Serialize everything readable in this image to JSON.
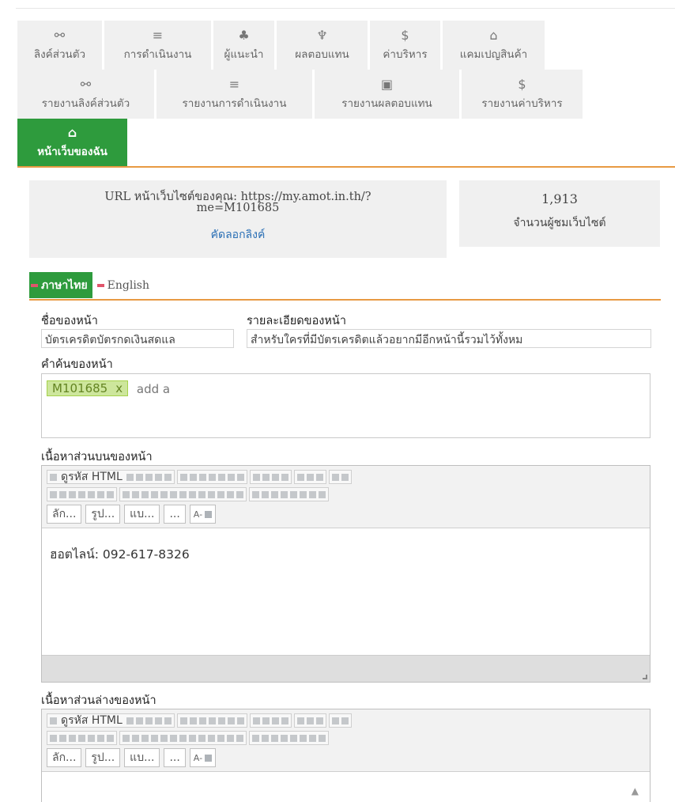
{
  "nav_row1": [
    {
      "icon": "link-icon",
      "glyph": "⚯",
      "label": "ลิงค์ส่วนตัว"
    },
    {
      "icon": "list-icon",
      "glyph": "≡",
      "label": "การดำเนินงาน"
    },
    {
      "icon": "org-chart-icon",
      "glyph": "♣",
      "label": "ผู้แนะนำ"
    },
    {
      "icon": "trophy-icon",
      "glyph": "♆",
      "label": "ผลตอบแทน"
    },
    {
      "icon": "dollar-icon",
      "glyph": "$",
      "label": "ค่าบริหาร"
    },
    {
      "icon": "gift-icon",
      "glyph": "⌂",
      "label": "แคมเปญสินค้า"
    }
  ],
  "nav_row2": [
    {
      "icon": "link-icon",
      "glyph": "⚯",
      "label": "รายงานลิงค์ส่วนตัว"
    },
    {
      "icon": "list-icon",
      "glyph": "≡",
      "label": "รายงานการดำเนินงาน"
    },
    {
      "icon": "money-icon",
      "glyph": "▣",
      "label": "รายงานผลตอบแทน"
    },
    {
      "icon": "dollar-icon",
      "glyph": "$",
      "label": "รายงานค่าบริหาร"
    }
  ],
  "nav_active": {
    "icon": "home-icon",
    "glyph": "⌂",
    "label": "หน้าเว็บของฉัน"
  },
  "url_info": {
    "line1": "URL หน้าเว็บไซต์ของคุณ: https://my.amot.in.th/?",
    "line2": "me=M101685",
    "copy_link": "คัดลอกลิงค์"
  },
  "visitors": {
    "count": "1,913",
    "label": "จำนวนผู้ชมเว็บไซต์"
  },
  "languages": {
    "active": "ภาษาไทย",
    "inactive": "English"
  },
  "form": {
    "page_name_label": "ชื่อของหน้า",
    "page_name_value": "บัตรเครดิตบัตรกดเงินสดแล",
    "page_desc_label": "รายละเอียดของหน้า",
    "page_desc_value": "สำหรับใครที่มีบัตรเครดิตแล้วอยากมีอีกหน้านี้รวมไว้ทั้งหม",
    "keywords_label": "คำค้นของหน้า",
    "keyword_tag": "M101685",
    "keyword_remove": "x",
    "keyword_input": "add a",
    "top_content_label": "เนื้อหาส่วนบนของหน้า",
    "top_content_text": "ฮอตไลน์: 092-617-8326",
    "bottom_content_label": "เนื้อหาส่วนล่างของหน้า"
  },
  "editor": {
    "source_label": "ดูรหัส HTML",
    "dropdown_style": "ลัก...",
    "dropdown_format": "รูป...",
    "dropdown_font": "แบ...",
    "dropdown_size": "...",
    "color_label": "A-"
  }
}
